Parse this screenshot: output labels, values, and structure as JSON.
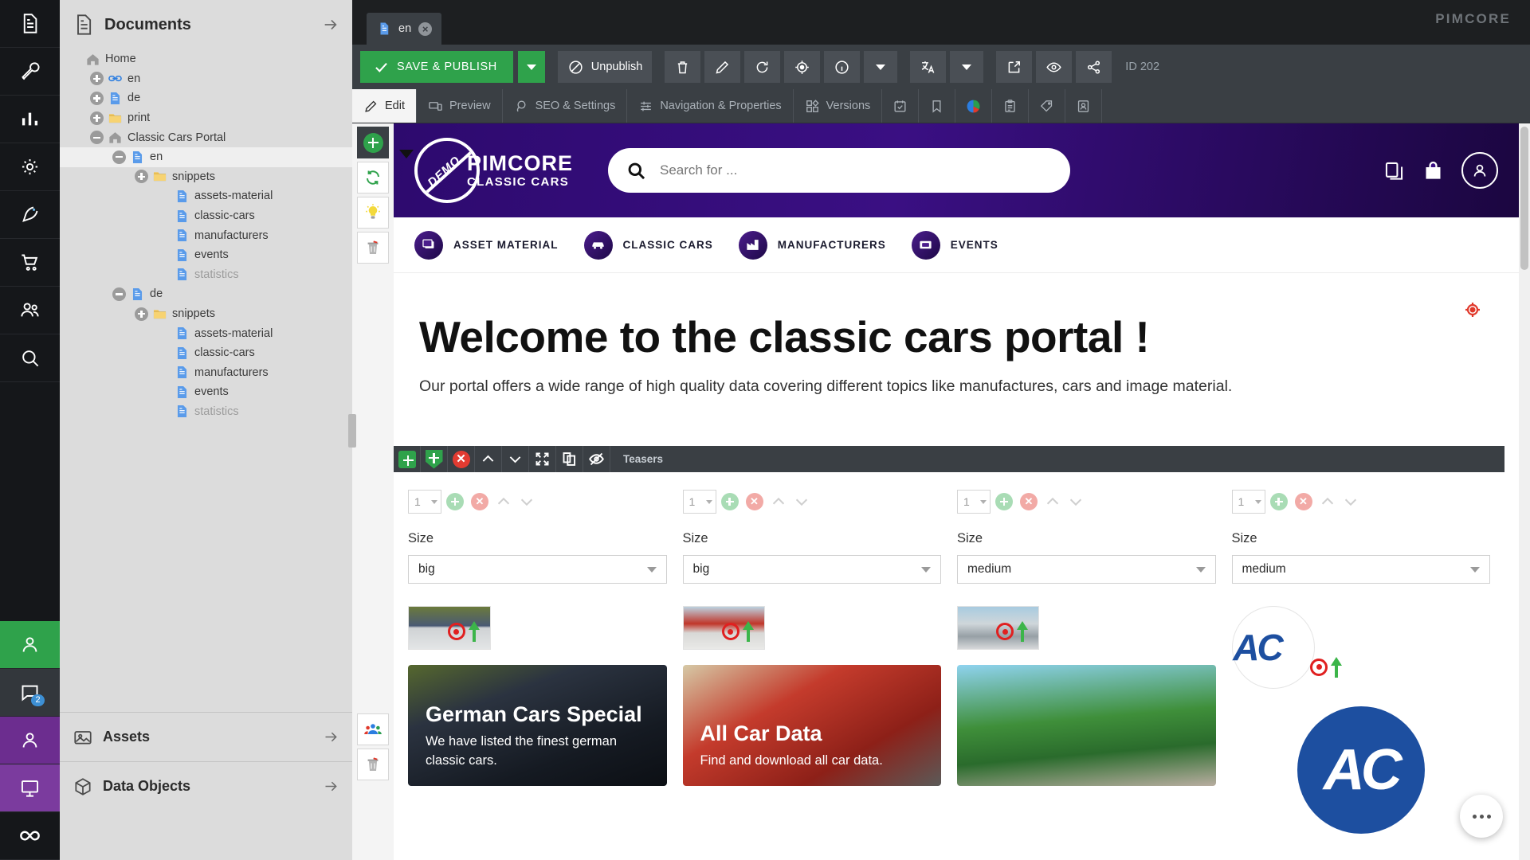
{
  "app": {
    "brand": "PIMCORE"
  },
  "left_rail": {
    "items": [
      {
        "name": "documents-icon",
        "label": "Documents"
      },
      {
        "name": "tools-icon",
        "label": "Tools"
      },
      {
        "name": "reports-icon",
        "label": "Reports"
      },
      {
        "name": "settings-icon",
        "label": "Settings"
      },
      {
        "name": "marketing-icon",
        "label": "Marketing"
      },
      {
        "name": "ecommerce-icon",
        "label": "E-Commerce"
      },
      {
        "name": "customers-icon",
        "label": "Customers"
      },
      {
        "name": "search-icon",
        "label": "Search"
      }
    ],
    "bottom_items": [
      {
        "name": "profile-green-icon",
        "label": "Profile",
        "badge": ""
      },
      {
        "name": "chat-icon",
        "label": "Messages",
        "badge": "2"
      },
      {
        "name": "user-icon",
        "label": "User"
      },
      {
        "name": "presentation-icon",
        "label": "Presentation"
      },
      {
        "name": "infinity-icon",
        "label": "Infinity"
      }
    ]
  },
  "tree_panel": {
    "title": "Documents",
    "nodes": [
      {
        "label": "Home",
        "indent": 0,
        "expander": "none",
        "icon": "home",
        "dim": false,
        "selected": false
      },
      {
        "label": "en",
        "indent": 1,
        "expander": "plus",
        "icon": "link",
        "dim": false,
        "selected": false
      },
      {
        "label": "de",
        "indent": 1,
        "expander": "plus",
        "icon": "page",
        "dim": false,
        "selected": false
      },
      {
        "label": "print",
        "indent": 1,
        "expander": "plus",
        "icon": "folder",
        "dim": false,
        "selected": false
      },
      {
        "label": "Classic Cars Portal",
        "indent": 1,
        "expander": "minus",
        "icon": "home",
        "dim": false,
        "selected": false
      },
      {
        "label": "en",
        "indent": 2,
        "expander": "minus",
        "icon": "page",
        "dim": false,
        "selected": true
      },
      {
        "label": "snippets",
        "indent": 3,
        "expander": "plus",
        "icon": "folder",
        "dim": false,
        "selected": false
      },
      {
        "label": "assets-material",
        "indent": 4,
        "expander": "none",
        "icon": "page",
        "dim": false,
        "selected": false
      },
      {
        "label": "classic-cars",
        "indent": 4,
        "expander": "none",
        "icon": "page",
        "dim": false,
        "selected": false
      },
      {
        "label": "manufacturers",
        "indent": 4,
        "expander": "none",
        "icon": "page",
        "dim": false,
        "selected": false
      },
      {
        "label": "events",
        "indent": 4,
        "expander": "none",
        "icon": "page",
        "dim": false,
        "selected": false
      },
      {
        "label": "statistics",
        "indent": 4,
        "expander": "none",
        "icon": "page",
        "dim": true,
        "selected": false
      },
      {
        "label": "de",
        "indent": 2,
        "expander": "minus",
        "icon": "page",
        "dim": false,
        "selected": false
      },
      {
        "label": "snippets",
        "indent": 3,
        "expander": "plus",
        "icon": "folder",
        "dim": false,
        "selected": false
      },
      {
        "label": "assets-material",
        "indent": 4,
        "expander": "none",
        "icon": "page",
        "dim": false,
        "selected": false
      },
      {
        "label": "classic-cars",
        "indent": 4,
        "expander": "none",
        "icon": "page",
        "dim": false,
        "selected": false
      },
      {
        "label": "manufacturers",
        "indent": 4,
        "expander": "none",
        "icon": "page",
        "dim": false,
        "selected": false
      },
      {
        "label": "events",
        "indent": 4,
        "expander": "none",
        "icon": "page",
        "dim": false,
        "selected": false
      },
      {
        "label": "statistics",
        "indent": 4,
        "expander": "none",
        "icon": "page",
        "dim": true,
        "selected": false
      }
    ],
    "footer": [
      {
        "label": "Assets",
        "icon": "assets-icon"
      },
      {
        "label": "Data Objects",
        "icon": "data-objects-icon"
      }
    ]
  },
  "document_tab": {
    "label": "en"
  },
  "toolbar": {
    "save_publish_label": "SAVE & PUBLISH",
    "unpublish_label": "Unpublish",
    "doc_id": "ID 202",
    "icon_buttons": [
      {
        "name": "delete-button",
        "icon": "trash"
      },
      {
        "name": "rename-button",
        "icon": "pencil"
      },
      {
        "name": "reload-button",
        "icon": "reload"
      },
      {
        "name": "locate-button",
        "icon": "target"
      },
      {
        "name": "info-button",
        "icon": "info"
      },
      {
        "name": "info-caret",
        "icon": "caret"
      },
      {
        "name": "translate-button",
        "icon": "translate"
      },
      {
        "name": "translate-caret",
        "icon": "caret"
      },
      {
        "name": "open-new-window-button",
        "icon": "external"
      },
      {
        "name": "preview-button",
        "icon": "eye"
      },
      {
        "name": "share-button",
        "icon": "share"
      }
    ]
  },
  "tabs": [
    {
      "label": "Edit",
      "icon": "pencil-icon",
      "active": true
    },
    {
      "label": "Preview",
      "icon": "devices-icon",
      "active": false
    },
    {
      "label": "SEO & Settings",
      "icon": "seo-icon",
      "active": false
    },
    {
      "label": "Navigation & Properties",
      "icon": "sliders-icon",
      "active": false
    },
    {
      "label": "Versions",
      "icon": "versions-icon",
      "active": false
    }
  ],
  "icon_tabs": [
    {
      "name": "tab-schedule",
      "icon": "calendar-check-icon"
    },
    {
      "name": "tab-bookmark",
      "icon": "bookmark-icon"
    },
    {
      "name": "tab-analytics",
      "icon": "pie-chart-icon"
    },
    {
      "name": "tab-tasks",
      "icon": "clipboard-icon"
    },
    {
      "name": "tab-tags",
      "icon": "tag-icon"
    },
    {
      "name": "tab-targeting",
      "icon": "contact-card-icon"
    }
  ],
  "edit_rail": {
    "top": [
      {
        "name": "add-element-button",
        "icon": "plus-circle-green"
      },
      {
        "name": "refresh-button",
        "icon": "refresh-green"
      },
      {
        "name": "hint-button",
        "icon": "lightbulb"
      },
      {
        "name": "delete-block-button",
        "icon": "trash-red"
      }
    ],
    "bottom": [
      {
        "name": "targeting-group-button",
        "icon": "people"
      },
      {
        "name": "remove-button",
        "icon": "trash-red"
      }
    ]
  },
  "site": {
    "logo": {
      "badge": "DEMO",
      "name": "PIMCORE",
      "tagline": "CLASSIC CARS"
    },
    "search": {
      "placeholder": "Search for ...",
      "value": ""
    },
    "header_icons": [
      {
        "name": "compare-icon"
      },
      {
        "name": "cart-icon"
      },
      {
        "name": "account-icon"
      }
    ],
    "nav": [
      {
        "label": "ASSET MATERIAL",
        "icon": "images-icon"
      },
      {
        "label": "CLASSIC CARS",
        "icon": "car-icon"
      },
      {
        "label": "MANUFACTURERS",
        "icon": "factory-icon"
      },
      {
        "label": "EVENTS",
        "icon": "ticket-icon"
      }
    ],
    "hero": {
      "title": "Welcome to the classic cars portal !",
      "subtitle": "Our portal offers a wide range of high quality data covering different topics like manufactures, cars and image material."
    }
  },
  "teasers_block": {
    "label": "Teasers",
    "toolbar_buttons": [
      {
        "name": "add-block-above-button",
        "icon": "plus-green-square"
      },
      {
        "name": "add-block-button",
        "icon": "plus-green-shield"
      },
      {
        "name": "remove-block-button",
        "icon": "x-red-circle"
      },
      {
        "name": "move-up-button",
        "icon": "chevron-up"
      },
      {
        "name": "move-down-button",
        "icon": "chevron-down"
      },
      {
        "name": "expand-button",
        "icon": "expand-arrows"
      },
      {
        "name": "copy-button",
        "icon": "copy"
      },
      {
        "name": "hide-button",
        "icon": "eye-off"
      }
    ]
  },
  "teaser_columns": [
    {
      "index": "1",
      "size_label": "Size",
      "size_value": "big",
      "card_title": "German Cars Special",
      "card_subtitle": "We have listed the finest german classic cars.",
      "thumb_kind": "mercedes"
    },
    {
      "index": "1",
      "size_label": "Size",
      "size_value": "big",
      "card_title": "All Car Data",
      "card_subtitle": "Find and download all car data.",
      "thumb_kind": "red-car"
    },
    {
      "index": "1",
      "size_label": "Size",
      "size_value": "medium",
      "card_title": "",
      "card_subtitle": "",
      "thumb_kind": "palm"
    },
    {
      "index": "1",
      "size_label": "Size",
      "size_value": "medium",
      "card_title": "",
      "card_subtitle": "",
      "thumb_kind": "ac-logo"
    }
  ],
  "colors": {
    "publish_green": "#2fa24b",
    "danger_red": "#e23b31",
    "brand_purple": "#3a0f83",
    "panel_gray": "#dcdcdc",
    "toolbar_dark": "#3a3f44",
    "rail_dark": "#15171a"
  }
}
